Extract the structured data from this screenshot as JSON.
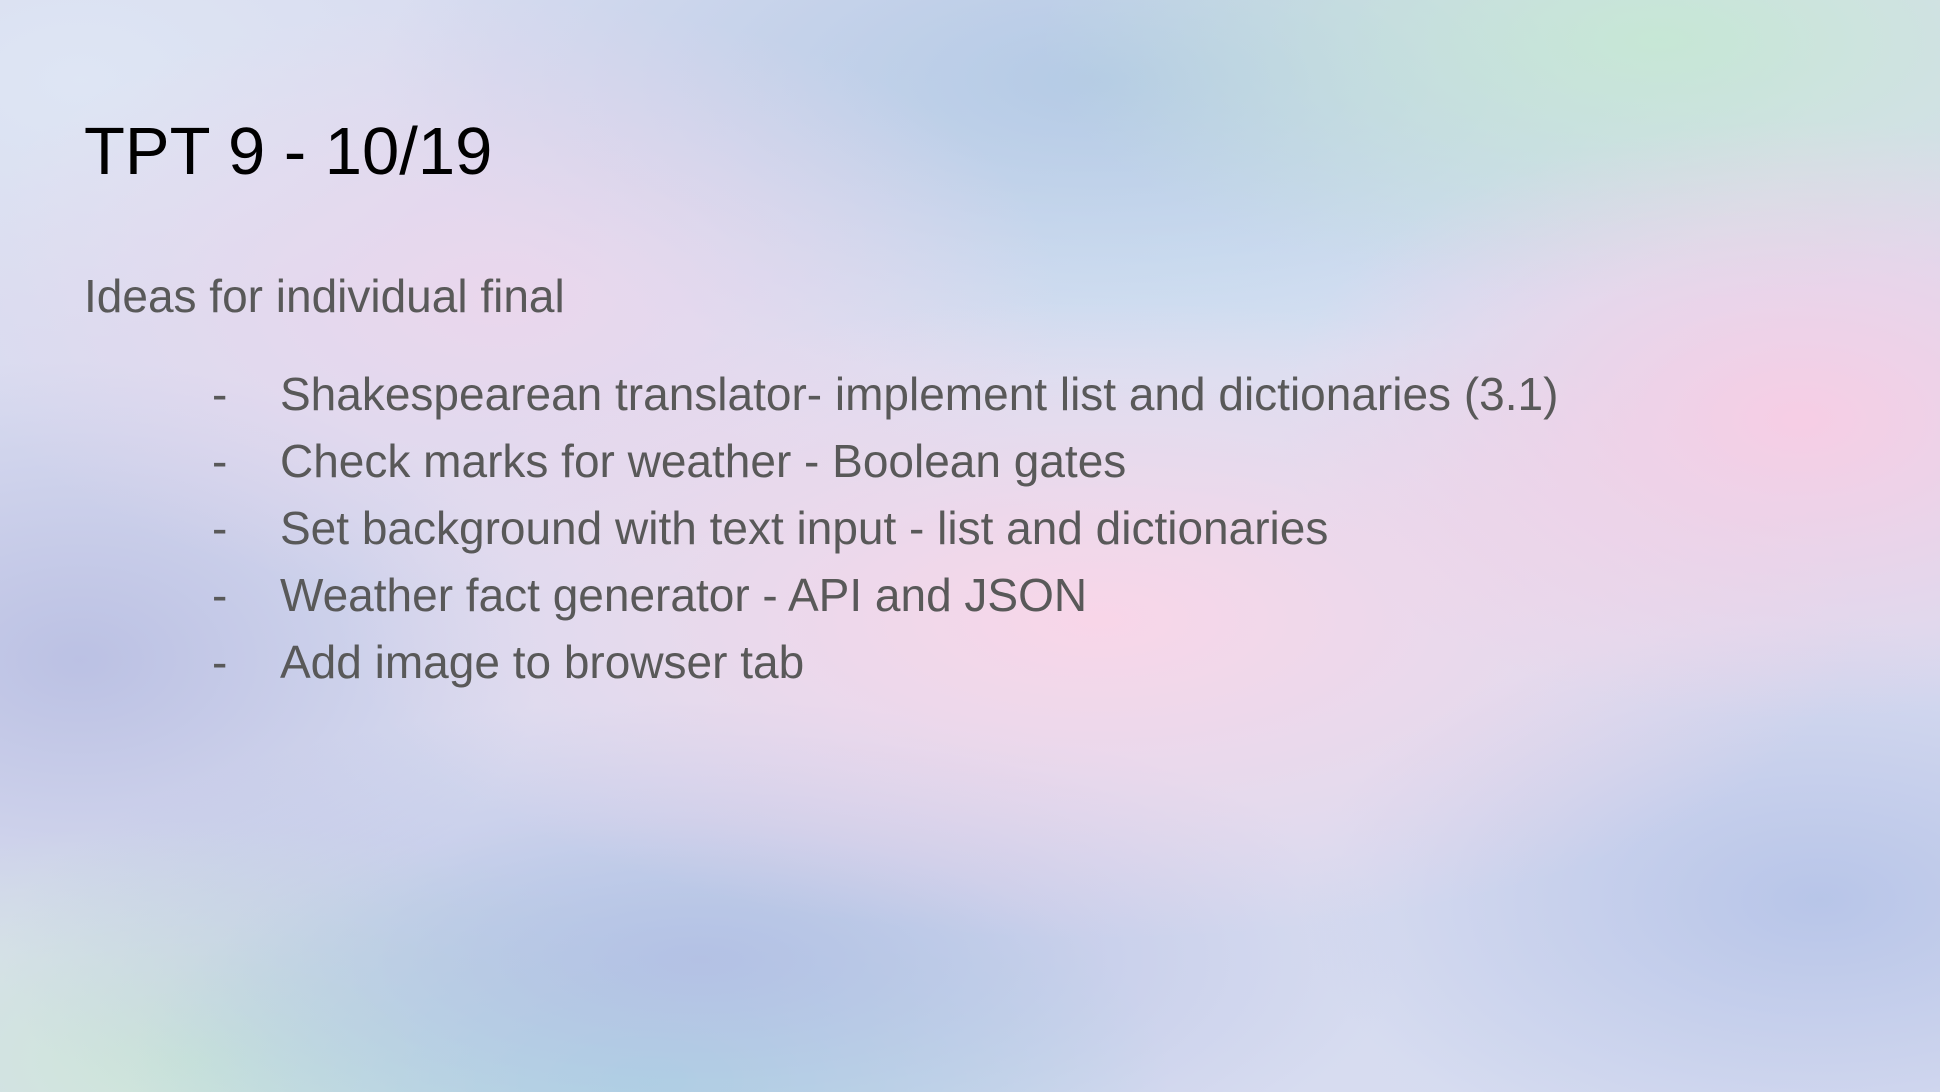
{
  "slide": {
    "title": "TPT 9 - 10/19",
    "subtitle": "Ideas for individual final",
    "bullet_marker": "-",
    "items": [
      "Shakespearean translator- implement list and dictionaries (3.1)",
      "Check marks for weather - Boolean gates",
      "Set background with text input - list and dictionaries",
      "Weather fact generator - API and JSON",
      "Add image to browser tab"
    ]
  },
  "colors": {
    "title_text": "#000000",
    "body_text": "#595959"
  }
}
